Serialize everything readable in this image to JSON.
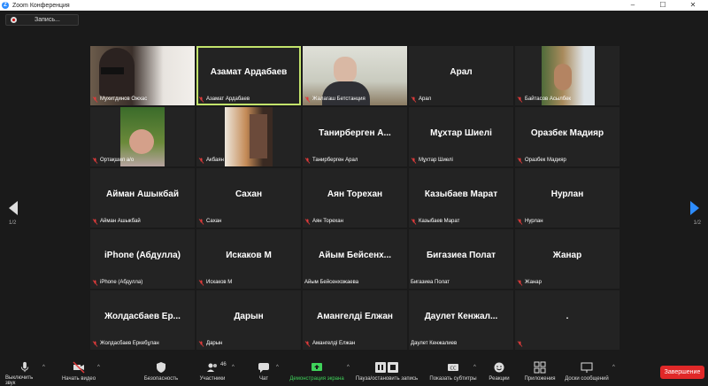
{
  "window": {
    "title": "Zoom Конференция",
    "app_icon": "Z",
    "min_glyph": "–",
    "max_glyph": "☐",
    "close_glyph": "✕"
  },
  "recording": {
    "label": "Запись..."
  },
  "pager": {
    "left": "1/2",
    "right": "1/2"
  },
  "tiles": [
    {
      "big": "",
      "caption": "Мухитдинов Ожхас",
      "video": true,
      "muted": true
    },
    {
      "big": "Азамат Ардабаев",
      "caption": "Азамат Ардабаев",
      "video": false,
      "muted": true,
      "active": true
    },
    {
      "big": "",
      "caption": "Жалагаш Бетстанция",
      "video": true,
      "muted": true
    },
    {
      "big": "Арал",
      "caption": "Арал",
      "video": false,
      "muted": true
    },
    {
      "big": "",
      "caption": "Байтасов Асылбек",
      "video": true,
      "muted": true
    },
    {
      "big": "",
      "caption": "Ортақшил а/о",
      "video": true,
      "muted": true
    },
    {
      "big": "",
      "caption": "Акбаян",
      "video": true,
      "muted": true
    },
    {
      "big": "Танирберген А...",
      "caption": "Танирберген Арал",
      "video": false,
      "muted": true
    },
    {
      "big": "Мұхтар Шиелі",
      "caption": "Мұхтар Шиелі",
      "video": false,
      "muted": true
    },
    {
      "big": "Оразбек Мадияр",
      "caption": "Оразбек Мадияр",
      "video": false,
      "muted": true
    },
    {
      "big": "Айман Ашыкбай",
      "caption": "Айман Ашыкбай",
      "video": false,
      "muted": true
    },
    {
      "big": "Сахан",
      "caption": "Сахан",
      "video": false,
      "muted": true
    },
    {
      "big": "Аян Торехан",
      "caption": "Аян Торехан",
      "video": false,
      "muted": true
    },
    {
      "big": "Казыбаев Марат",
      "caption": "Казыбаев Марат",
      "video": false,
      "muted": true
    },
    {
      "big": "Нурлан",
      "caption": "Нурлан",
      "video": false,
      "muted": true
    },
    {
      "big": "iPhone (Абдулла)",
      "caption": "iPhone (Абдулла)",
      "video": false,
      "muted": true
    },
    {
      "big": "Искаков М",
      "caption": "Искаков М",
      "video": false,
      "muted": true
    },
    {
      "big": "Айым Бейсенх...",
      "caption": "Айым Бейсенхожаева",
      "video": false,
      "muted": false
    },
    {
      "big": "Бигазиеа Полат",
      "caption": "Бигазиеа Полат",
      "video": false,
      "muted": false
    },
    {
      "big": "Жанар",
      "caption": "Жанар",
      "video": false,
      "muted": true
    },
    {
      "big": "Жолдасбаев Ер...",
      "caption": "Жолдасбаев Еркебұлан",
      "video": false,
      "muted": true
    },
    {
      "big": "Дарын",
      "caption": "Дарын",
      "video": false,
      "muted": true
    },
    {
      "big": "Амангелді Елжан",
      "caption": "Амангелді Елжан",
      "video": false,
      "muted": true
    },
    {
      "big": "Даулет Кенжал...",
      "caption": "Даулет Кенжалиев",
      "video": false,
      "muted": false
    },
    {
      "big": ".",
      "caption": "",
      "video": false,
      "muted": true
    }
  ],
  "toolbar": {
    "mute": "Выключить звук",
    "video": "Начать видео",
    "security": "Безопасность",
    "participants": "Участники",
    "participants_count": "46",
    "chat": "Чат",
    "share": "Демонстрация экрана",
    "record": "Пауза/остановить запись",
    "captions": "Показать субтитры",
    "reactions": "Реакции",
    "apps": "Приложения",
    "whiteboard": "Доски сообщений",
    "end": "Завершение"
  },
  "colors": {
    "accent_green": "#3fd25a",
    "active_border": "#c3e36b",
    "end_red": "#e02828",
    "muted_red": "#e23b3b"
  }
}
